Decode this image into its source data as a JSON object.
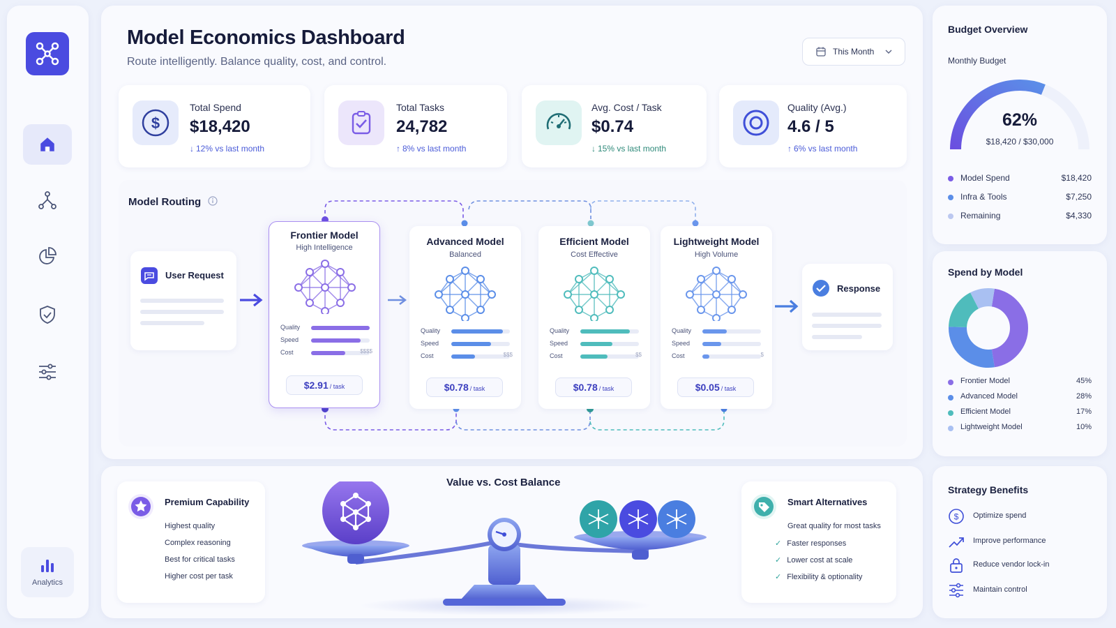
{
  "sidebar": {
    "nav": [
      "home-icon",
      "routing-icon",
      "pie-chart-icon",
      "shield-icon",
      "sliders-icon"
    ],
    "analytics_label": "Analytics"
  },
  "header": {
    "title": "Model Economics Dashboard",
    "subtitle": "Route intelligently. Balance quality, cost, and control.",
    "period": "This Month"
  },
  "kpis": [
    {
      "label": "Total Spend",
      "value": "$18,420",
      "change": "12% vs last month",
      "direction": "down",
      "icon": "dollar-icon"
    },
    {
      "label": "Total Tasks",
      "value": "24,782",
      "change": "8% vs last month",
      "direction": "up",
      "icon": "checklist-icon"
    },
    {
      "label": "Avg. Cost / Task",
      "value": "$0.74",
      "change": "15% vs last month",
      "direction": "down",
      "icon": "speedometer-icon"
    },
    {
      "label": "Quality (Avg.)",
      "value": "4.6 / 5",
      "change": "6% vs last month",
      "direction": "up",
      "icon": "target-icon"
    }
  ],
  "routing": {
    "title": "Model Routing",
    "request": "User Request",
    "response": "Response",
    "metric_labels": [
      "Quality",
      "Speed",
      "Cost"
    ],
    "models": [
      {
        "name": "Frontier Model",
        "subtitle": "High Intelligence",
        "price": "$2.91",
        "unit": "/ task",
        "quality": 1.0,
        "speed": 0.85,
        "cost": 0.58,
        "cost_tier": "$$$$",
        "color": "#8a6ee6"
      },
      {
        "name": "Advanced Model",
        "subtitle": "Balanced",
        "price": "$0.78",
        "unit": "/ task",
        "quality": 0.88,
        "speed": 0.68,
        "cost": 0.4,
        "cost_tier": "$$$",
        "color": "#5b8ee8"
      },
      {
        "name": "Efficient Model",
        "subtitle": "Cost Effective",
        "price": "$0.78",
        "unit": "/ task",
        "quality": 0.85,
        "speed": 0.55,
        "cost": 0.46,
        "cost_tier": "$$",
        "color": "#4fbcbc"
      },
      {
        "name": "Lightweight Model",
        "subtitle": "High Volume",
        "price": "$0.05",
        "unit": "/ task",
        "quality": 0.42,
        "speed": 0.32,
        "cost": 0.12,
        "cost_tier": "$",
        "color": "#6a96ec"
      }
    ]
  },
  "balance": {
    "title": "Value vs. Cost Balance",
    "premium": {
      "title": "Premium Capability",
      "items": [
        "Highest quality",
        "Complex reasoning",
        "Best for critical tasks",
        "Higher cost per task"
      ]
    },
    "alternatives": {
      "title": "Smart Alternatives",
      "items": [
        "Great quality for most tasks",
        "Faster responses",
        "Lower cost at scale",
        "Flexibility & optionality"
      ]
    }
  },
  "budget": {
    "title": "Budget Overview",
    "subtitle": "Monthly Budget",
    "percent": 62,
    "percent_label": "62%",
    "amount_label": "$18,420 / $30,000",
    "items": [
      {
        "name": "Model Spend",
        "value": "$18,420",
        "color": "#7a5ce6"
      },
      {
        "name": "Infra & Tools",
        "value": "$7,250",
        "color": "#5b8ee8"
      },
      {
        "name": "Remaining",
        "value": "$4,330",
        "color": "#bcc8f0"
      }
    ]
  },
  "spend_by_model": {
    "title": "Spend by Model",
    "items": [
      {
        "name": "Frontier Model",
        "value": "45%",
        "pct": 45,
        "color": "#8a6ee6"
      },
      {
        "name": "Advanced Model",
        "value": "28%",
        "pct": 28,
        "color": "#5b8ee8"
      },
      {
        "name": "Efficient Model",
        "value": "17%",
        "pct": 17,
        "color": "#4fbcbc"
      },
      {
        "name": "Lightweight Model",
        "value": "10%",
        "pct": 10,
        "color": "#a9c0f2"
      }
    ]
  },
  "strategy": {
    "title": "Strategy Benefits",
    "items": [
      "Optimize spend",
      "Improve performance",
      "Reduce vendor lock-in",
      "Maintain control"
    ]
  }
}
